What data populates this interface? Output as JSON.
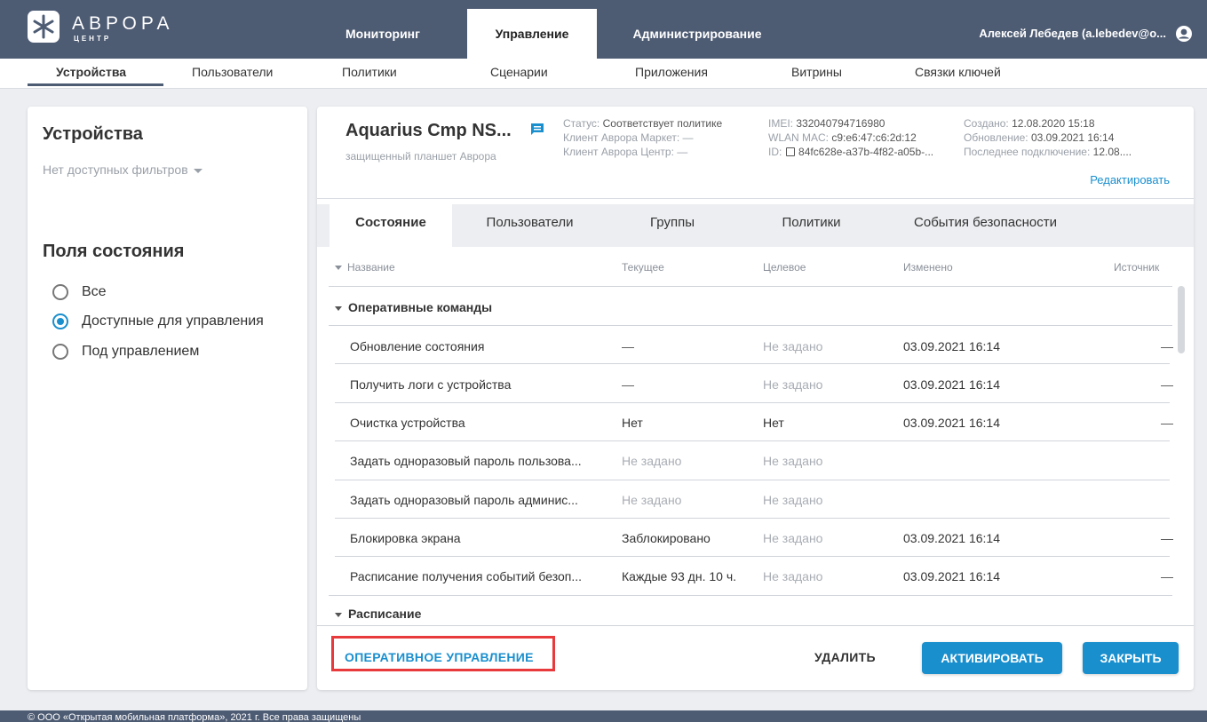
{
  "app": {
    "logo_text": "АВРОРА",
    "logo_subtext": "ЦЕНТР",
    "user": "Алексей Лебедев (a.lebedev@o..."
  },
  "top_nav": [
    "Мониторинг",
    "Управление",
    "Администрирование"
  ],
  "sub_nav": [
    "Устройства",
    "Пользователи",
    "Политики",
    "Сценарии",
    "Приложения",
    "Витрины",
    "Связки ключей"
  ],
  "sidebar": {
    "title": "Устройства",
    "filter": "Нет доступных фильтров",
    "fields_title": "Поля состояния",
    "options": [
      "Все",
      "Доступные для управления",
      "Под управлением"
    ],
    "selected_index": 1
  },
  "device": {
    "name": "Aquarius Cmp NS...",
    "type": "защищенный планшет Аврора",
    "status_label": "Статус:",
    "status_value": "Соответствует политике",
    "market_label": "Клиент Аврора Маркет:",
    "market_value": "—",
    "center_label": "Клиент Аврора Центр:",
    "center_value": "—",
    "imei_label": "IMEI:",
    "imei_value": "332040794716980",
    "mac_label": "WLAN MAC:",
    "mac_value": "c9:e6:47:c6:2d:12",
    "id_label": "ID:",
    "id_value": "84fc628e-a37b-4f82-a05b-...",
    "created_label": "Создано:",
    "created_value": "12.08.2020 15:18",
    "updated_label": "Обновление:",
    "updated_value": "03.09.2021 16:14",
    "last_conn_label": "Последнее подключение:",
    "last_conn_value": "12.08....",
    "edit": "Редактировать"
  },
  "tabs": [
    "Состояние",
    "Пользователи",
    "Группы",
    "Политики",
    "События безопасности"
  ],
  "table": {
    "headers": [
      "Название",
      "Текущее",
      "Целевое",
      "Изменено",
      "Источник"
    ],
    "group1": "Оперативные команды",
    "rows": [
      [
        "Обновление состояния",
        "—",
        "Не задано",
        "03.09.2021 16:14",
        "—"
      ],
      [
        "Получить логи с устройства",
        "—",
        "Не задано",
        "03.09.2021 16:14",
        "—"
      ],
      [
        "Очистка устройства",
        "Нет",
        "Нет",
        "03.09.2021 16:14",
        "—"
      ],
      [
        "Задать одноразовый пароль пользова...",
        "Не задано",
        "Не задано",
        "",
        ""
      ],
      [
        "Задать одноразовый пароль админис...",
        "Не задано",
        "Не задано",
        "",
        ""
      ],
      [
        "Блокировка экрана",
        "Заблокировано",
        "Не задано",
        "03.09.2021 16:14",
        "—"
      ],
      [
        "Расписание получения событий безоп...",
        "Каждые 93 дн. 10 ч.",
        "Не задано",
        "03.09.2021 16:14",
        "—"
      ]
    ],
    "group2": "Расписание"
  },
  "actions": {
    "operational": "ОПЕРАТИВНОЕ УПРАВЛЕНИЕ",
    "delete": "УДАЛИТЬ",
    "activate": "АКТИВИРОВАТЬ",
    "close": "ЗАКРЫТЬ"
  },
  "footer": "© ООО «Открытая мобильная платформа», 2021 г. Все права защищены"
}
